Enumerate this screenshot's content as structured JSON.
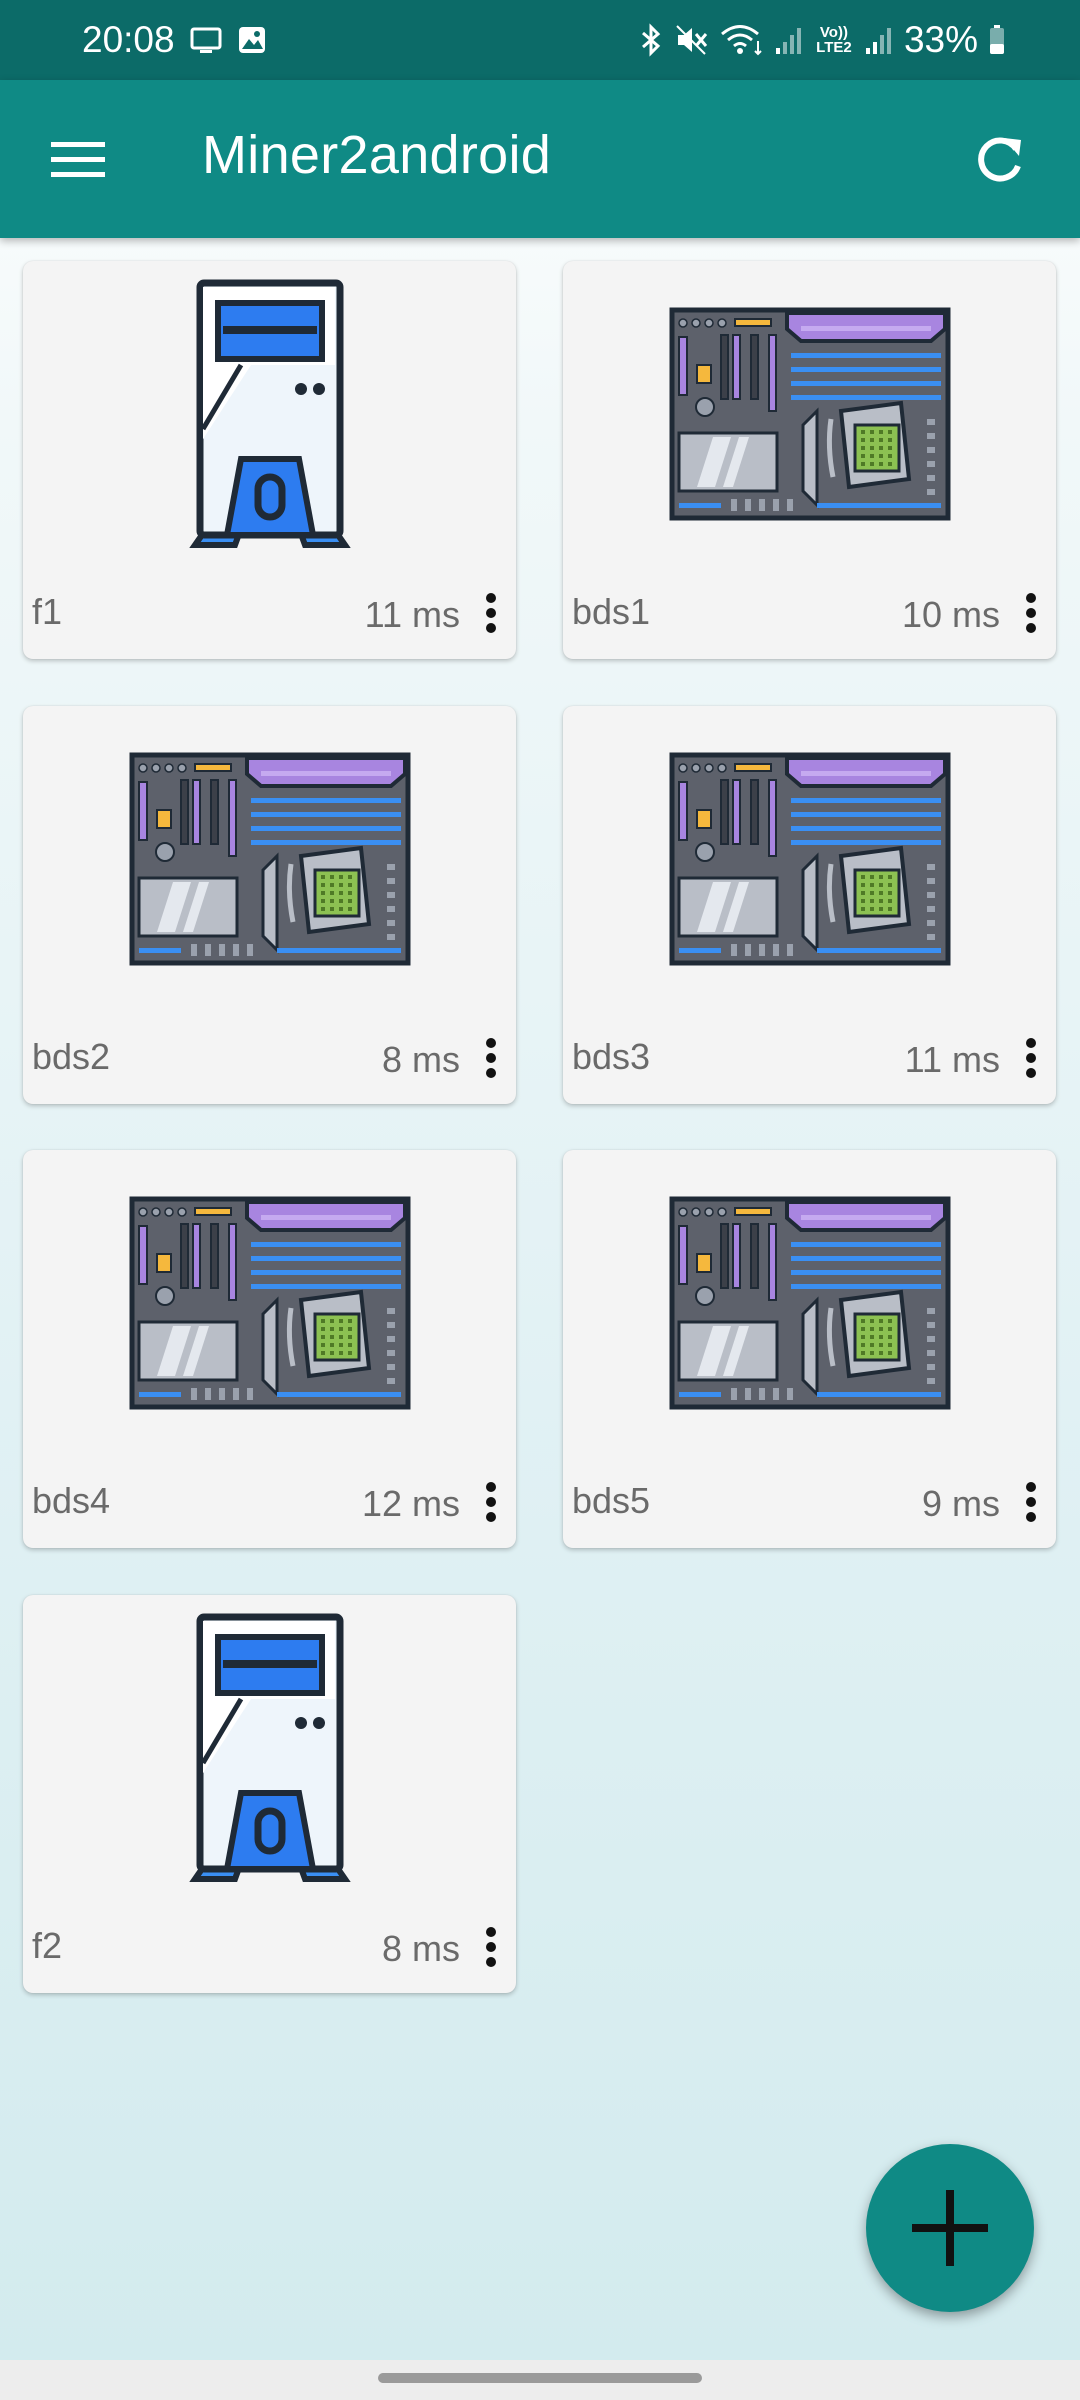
{
  "status_bar": {
    "time": "20:08",
    "volte_label": "Vo)) LTE2",
    "battery": "33%"
  },
  "app_bar": {
    "title": "Miner2android"
  },
  "miners": [
    {
      "name": "f1",
      "latency": "11 ms",
      "icon": "pc-tower-icon"
    },
    {
      "name": "bds1",
      "latency": "10 ms",
      "icon": "motherboard-icon"
    },
    {
      "name": "bds2",
      "latency": "8 ms",
      "icon": "motherboard-icon"
    },
    {
      "name": "bds3",
      "latency": "11 ms",
      "icon": "motherboard-icon"
    },
    {
      "name": "bds4",
      "latency": "12 ms",
      "icon": "motherboard-icon"
    },
    {
      "name": "bds5",
      "latency": "9 ms",
      "icon": "motherboard-icon"
    },
    {
      "name": "f2",
      "latency": "8 ms",
      "icon": "pc-tower-icon"
    }
  ],
  "fab": {
    "icon": "plus-icon"
  },
  "colors": {
    "status_bar": "#0c6b68",
    "app_bar": "#0f8a85",
    "card": "#f4f4f4",
    "tower_blue": "#2d7cf0",
    "board_gray": "#5d616b",
    "board_purple": "#a885e0"
  }
}
